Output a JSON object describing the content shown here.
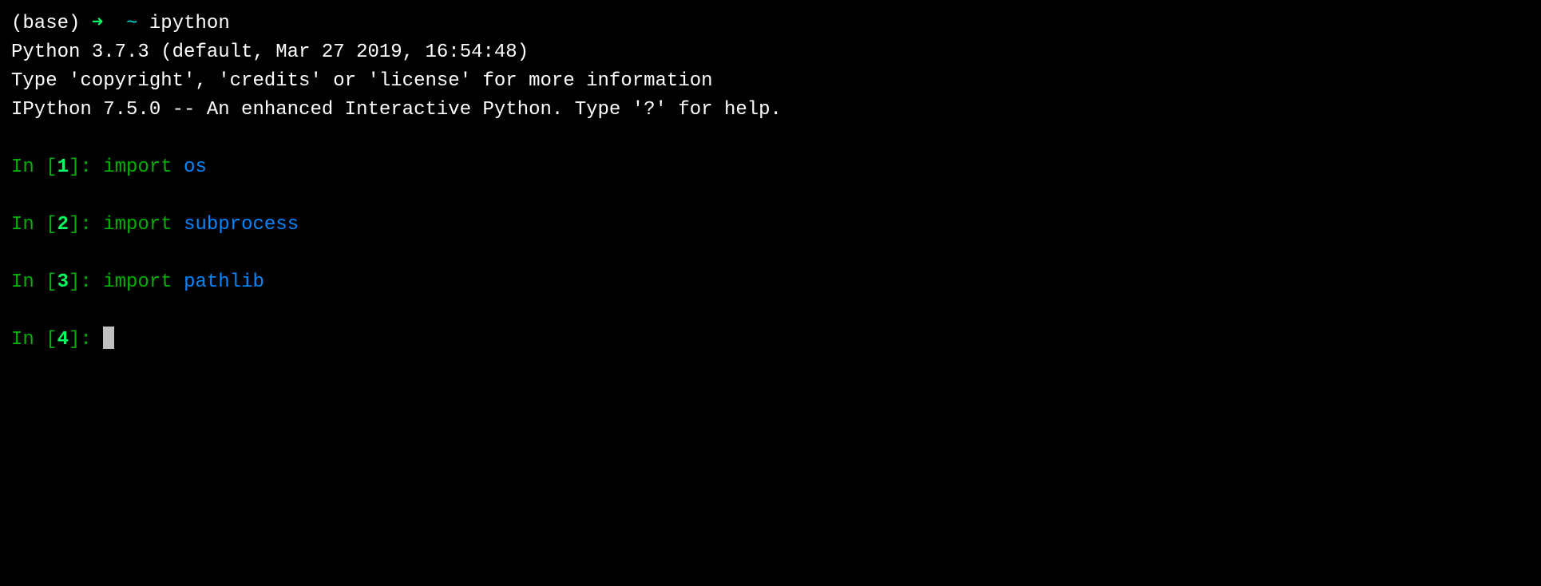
{
  "shell": {
    "conda_env": "(base)",
    "arrow": "➜",
    "tilde": "~",
    "command": "ipython"
  },
  "header": {
    "line1": "Python 3.7.3 (default, Mar 27 2019, 16:54:48)",
    "line2": "Type 'copyright', 'credits' or 'license' for more information",
    "line3": "IPython 7.5.0 -- An enhanced Interactive Python. Type '?' for help."
  },
  "cells": [
    {
      "in_label": "In ",
      "bracket_open": "[",
      "num": "1",
      "bracket_close": "]: ",
      "keyword": "import",
      "module": "os"
    },
    {
      "in_label": "In ",
      "bracket_open": "[",
      "num": "2",
      "bracket_close": "]: ",
      "keyword": "import",
      "module": "subprocess"
    },
    {
      "in_label": "In ",
      "bracket_open": "[",
      "num": "3",
      "bracket_close": "]: ",
      "keyword": "import",
      "module": "pathlib"
    },
    {
      "in_label": "In ",
      "bracket_open": "[",
      "num": "4",
      "bracket_close": "]: ",
      "keyword": "",
      "module": ""
    }
  ]
}
